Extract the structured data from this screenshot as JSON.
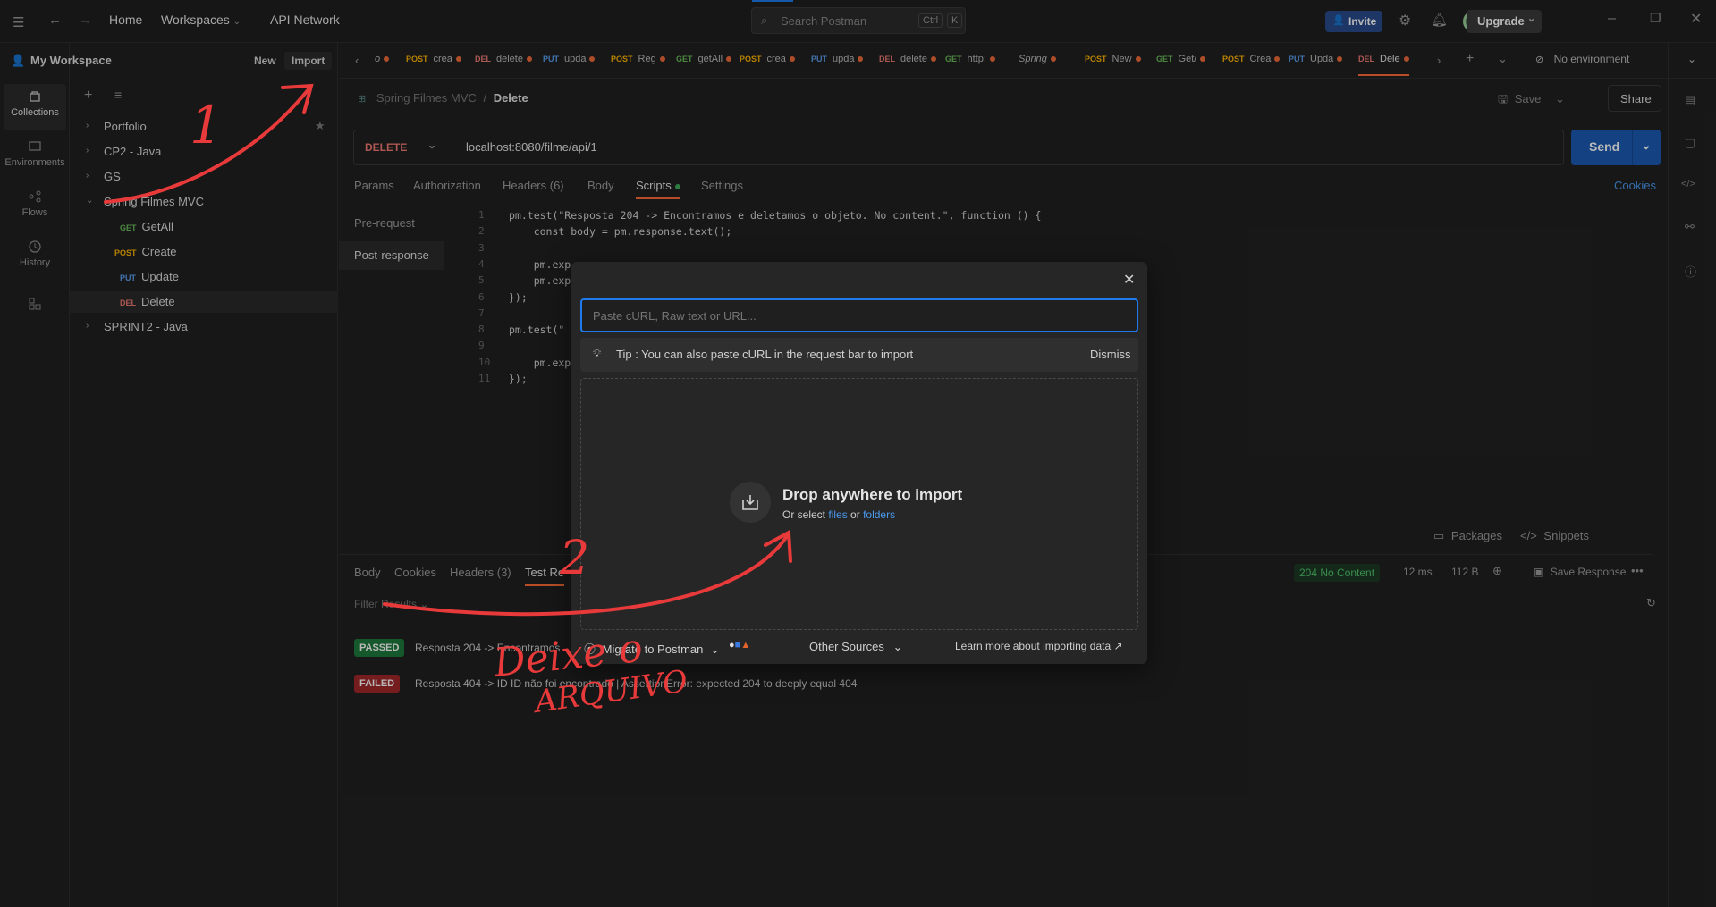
{
  "topbar": {
    "home": "Home",
    "workspaces": "Workspaces",
    "api_network": "API Network",
    "search_placeholder": "Search Postman",
    "kbd_ctrl": "Ctrl",
    "kbd_k": "K",
    "invite": "Invite",
    "upgrade": "Upgrade"
  },
  "rail": {
    "collections": "Collections",
    "environments": "Environments",
    "flows": "Flows",
    "history": "History"
  },
  "sidebar": {
    "workspace": "My Workspace",
    "new": "New",
    "import": "Import",
    "items": [
      {
        "label": "Portfolio"
      },
      {
        "label": "CP2 - Java"
      },
      {
        "label": "GS"
      },
      {
        "label": "Spring Filmes MVC"
      },
      {
        "label": "SPRINT2 - Java"
      }
    ],
    "requests": [
      {
        "method": "GET",
        "label": "GetAll"
      },
      {
        "method": "POST",
        "label": "Create"
      },
      {
        "method": "PUT",
        "label": "Update"
      },
      {
        "method": "DEL",
        "label": "Delete"
      }
    ]
  },
  "tabs": [
    {
      "method": "",
      "label": "o"
    },
    {
      "method": "POST",
      "label": "crea"
    },
    {
      "method": "DEL",
      "label": "delete"
    },
    {
      "method": "PUT",
      "label": "upda"
    },
    {
      "method": "POST",
      "label": "Reg"
    },
    {
      "method": "GET",
      "label": "getAll"
    },
    {
      "method": "POST",
      "label": "crea"
    },
    {
      "method": "PUT",
      "label": "upda"
    },
    {
      "method": "DEL",
      "label": "delete"
    },
    {
      "method": "GET",
      "label": "http:"
    },
    {
      "method": "",
      "label": "Spring"
    },
    {
      "method": "POST",
      "label": "New"
    },
    {
      "method": "GET",
      "label": "Get/"
    },
    {
      "method": "POST",
      "label": "Crea"
    },
    {
      "method": "PUT",
      "label": "Upda"
    },
    {
      "method": "DEL",
      "label": "Dele"
    }
  ],
  "environment": "No environment",
  "breadcrumb": {
    "collection": "Spring Filmes MVC",
    "sep": "/",
    "request": "Delete"
  },
  "request": {
    "method": "DELETE",
    "url": "localhost:8080/filme/api/1",
    "send": "Send",
    "save": "Save",
    "share": "Share",
    "tabs": [
      "Params",
      "Authorization",
      "Headers (6)",
      "Body",
      "Scripts",
      "Settings"
    ],
    "cookies": "Cookies"
  },
  "scripts": {
    "pre": "Pre-request",
    "post": "Post-response",
    "lines": [
      "pm.test(\"Resposta 204 -> Encontramos e deletamos o objeto. No content.\", function () {",
      "    const body = pm.response.text();",
      "",
      "    pm.exp",
      "    pm.exp",
      "});",
      "",
      "pm.test(\"",
      "",
      "    pm.exp",
      "});"
    ],
    "packages": "Packages",
    "snippets": "Snippets"
  },
  "response": {
    "tabs": [
      "Body",
      "Cookies",
      "Headers (3)",
      "Test Re"
    ],
    "status": "204 No Content",
    "time": "12 ms",
    "size": "112 B",
    "save": "Save Response",
    "filter": "Filter Results",
    "results": [
      {
        "status": "PASSED",
        "text": "Resposta 204 -> Encontramos"
      },
      {
        "status": "FAILED",
        "text": "Resposta 404 -> ID ID não foi encontrado | AssertionError: expected 204 to deeply equal 404"
      }
    ]
  },
  "modal": {
    "placeholder": "Paste cURL, Raw text or URL...",
    "tip": "Tip : You can also paste cURL in the request bar to import",
    "dismiss": "Dismiss",
    "drop_title": "Drop anywhere to import",
    "drop_or": "Or select",
    "files": "files",
    "or": "or",
    "folders": "folders",
    "migrate": "Migrate to Postman",
    "other_sources": "Other Sources",
    "learn_more": "Learn more about",
    "importing_data": "importing data"
  },
  "annotations": {
    "one": "1",
    "two": "2",
    "note_line1": "Deixe o",
    "note_line2": "ARQUIVO"
  },
  "colors": {
    "accent": "#ff6c37",
    "send_blue": "#1b5bb5",
    "focus_blue": "#1f7bea",
    "passed": "#1e7a3c",
    "failed": "#a3272a",
    "annotation_red": "#e83a3a"
  }
}
